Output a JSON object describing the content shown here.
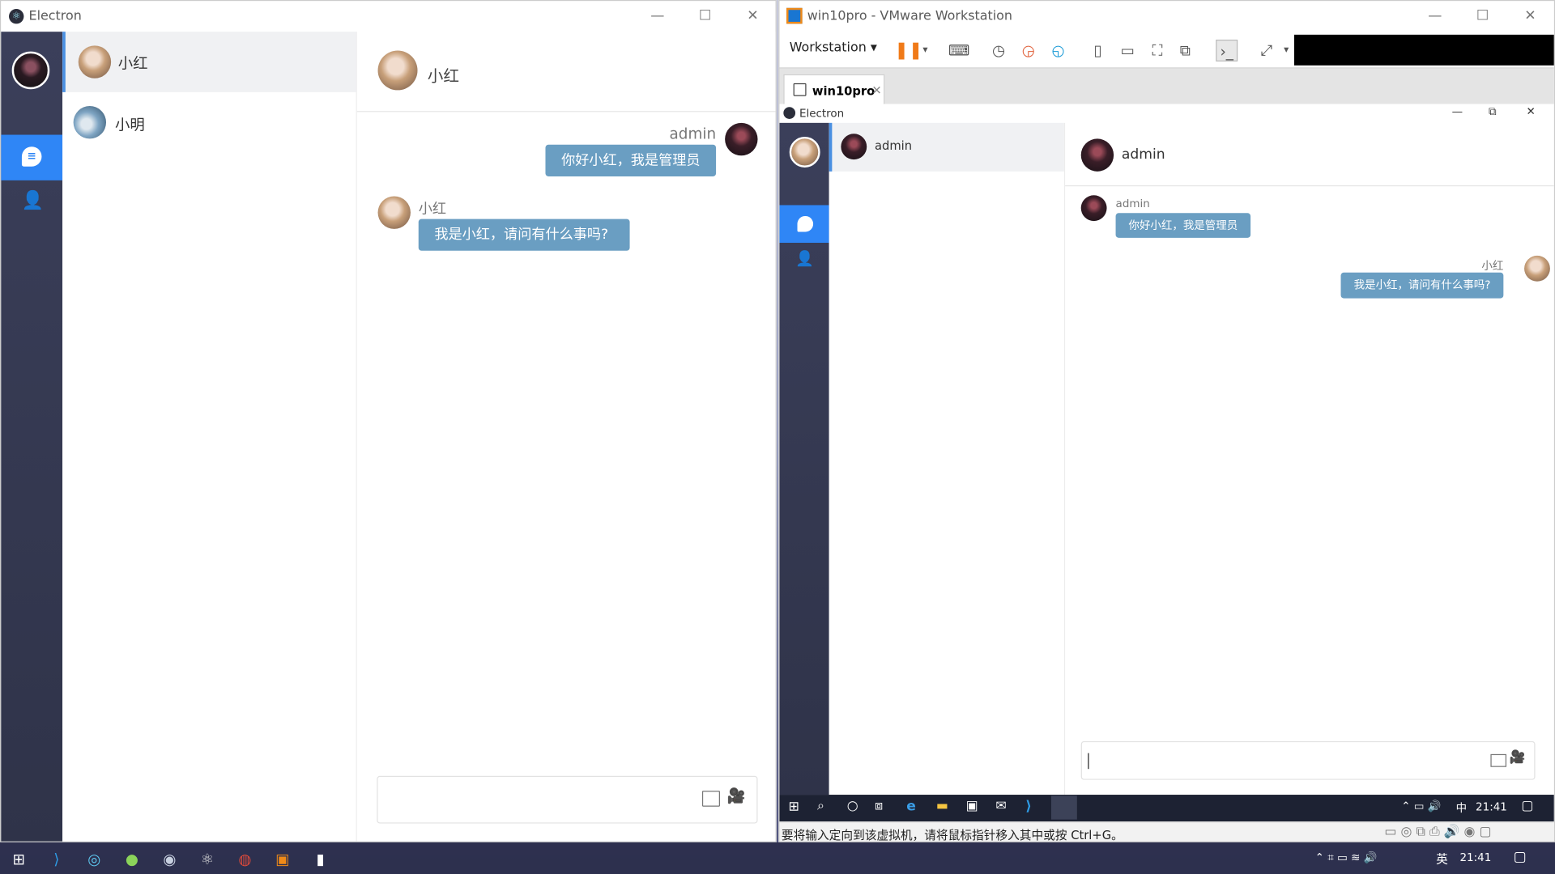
{
  "left_window": {
    "title": "Electron",
    "contacts": [
      {
        "name": "小红"
      },
      {
        "name": "小明"
      }
    ],
    "header_name": "小红",
    "messages": [
      {
        "sender": "admin",
        "text": "你好小红，我是管理员"
      },
      {
        "sender": "小红",
        "text": "我是小红，请问有什么事吗?"
      }
    ]
  },
  "right_window": {
    "title": "win10pro - VMware Workstation",
    "menu_label": "Workstation",
    "tab_label": "win10pro",
    "inner_title": "Electron",
    "inner_contact": "admin",
    "inner_header": "admin",
    "inner_messages": [
      {
        "sender": "admin",
        "text": "你好小红，我是管理员"
      },
      {
        "sender": "小红",
        "text": "我是小红，请问有什么事吗?"
      }
    ],
    "guest_clock": "21:41",
    "guest_ime": "中",
    "status_text": "要将输入定向到该虚拟机，请将鼠标指针移入其中或按 Ctrl+G。"
  },
  "host_taskbar": {
    "clock": "21:41",
    "ime": "英"
  },
  "icons": [
    "electron-icon",
    "chat-icon",
    "contacts-icon",
    "image-icon",
    "video-call-icon",
    "pause-icon",
    "snapshot-icon",
    "fullscreen-icon",
    "windows-start-icon",
    "search-icon",
    "edge-icon",
    "vscode-icon"
  ]
}
